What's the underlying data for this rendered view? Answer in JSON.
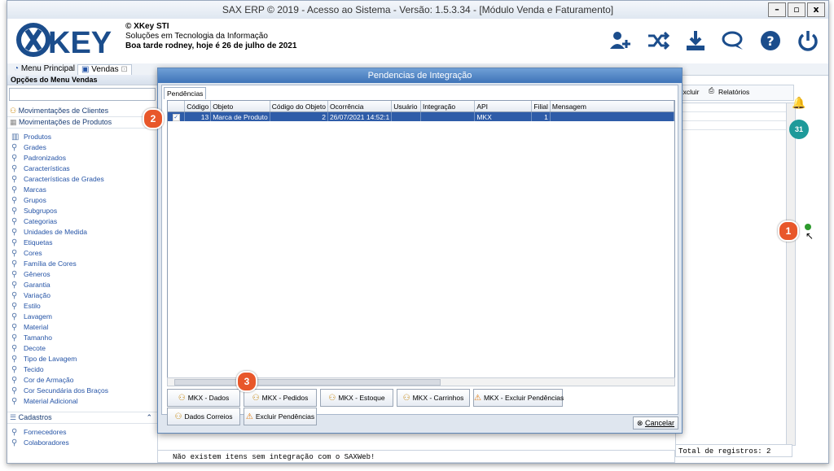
{
  "window": {
    "title": "SAX ERP © 2019 - Acesso ao Sistema - Versão: 1.5.3.34 - [Módulo Venda e Faturamento]",
    "controls": [
      "–",
      "▫",
      "x"
    ]
  },
  "brand": {
    "logo_text": "XKEY",
    "company": "© XKey STI",
    "tagline": "Soluções em Tecnologia da Informação",
    "greeting": "Boa tarde rodney, hoje é 26 de julho de 2021"
  },
  "tabs": [
    {
      "label": "Menu Principal"
    },
    {
      "label": "Vendas"
    }
  ],
  "sidebar": {
    "header": "Opções do Menu Vendas",
    "sections": [
      "Movimentações de Clientes",
      "Movimentações de Produtos"
    ],
    "items": [
      "Produtos",
      "Grades",
      "Padronizados",
      "Características",
      "Características de Grades",
      "Marcas",
      "Grupos",
      "Subgrupos",
      "Categorias",
      "Unidades de Medida",
      "Etiquetas",
      "Cores",
      "Família de Cores",
      "Gêneros",
      "Garantia",
      "Variação",
      "Estilo",
      "Lavagem",
      "Material",
      "Tamanho",
      "Decote",
      "Tipo de Lavagem",
      "Tecido",
      "Cor de Armação",
      "Cor Secundária dos Braços",
      "Material Adicional"
    ],
    "section3": "Cadastros",
    "items2": [
      "Fornecedores",
      "Colaboradores"
    ]
  },
  "rightpane": {
    "excluir": "Excluir",
    "relatorios": "Relatórios",
    "total": "Total de registros: 2"
  },
  "modal": {
    "title": "Pendencias de Integração",
    "tab": "Pendências",
    "columns": [
      "Código",
      "Objeto",
      "Código do Objeto",
      "Ocorrência",
      "Usuário",
      "Integração",
      "API",
      "Filial",
      "Mensagem"
    ],
    "rows": [
      {
        "codigo": "13",
        "objeto": "Marca de Produto",
        "codigo_objeto": "2",
        "ocorrencia": "26/07/2021 14:52:1",
        "usuario": "",
        "integracao": "",
        "api": "MKX",
        "filial": "1",
        "mensagem": ""
      }
    ],
    "buttons_row1": [
      "MKX - Dados",
      "MKX - Pedidos",
      "MKX - Estoque",
      "MKX - Carrinhos",
      "MKX - Excluir Pendências"
    ],
    "buttons_row2": [
      "Dados Correios",
      "Excluir Pendências"
    ],
    "cancel": "Cancelar"
  },
  "statusbar": "Não existem itens sem integração com o SAXWeb!",
  "callouts": [
    "1",
    "2",
    "3"
  ],
  "colors": {
    "accent": "#2e5ca8",
    "callout": "#e8572a",
    "title_bar": "#3f74b8"
  },
  "icons": [
    "user-add-icon",
    "shuffle-icon",
    "download-icon",
    "chat-icon",
    "help-icon",
    "power-icon",
    "bell-icon",
    "calendar-icon"
  ]
}
